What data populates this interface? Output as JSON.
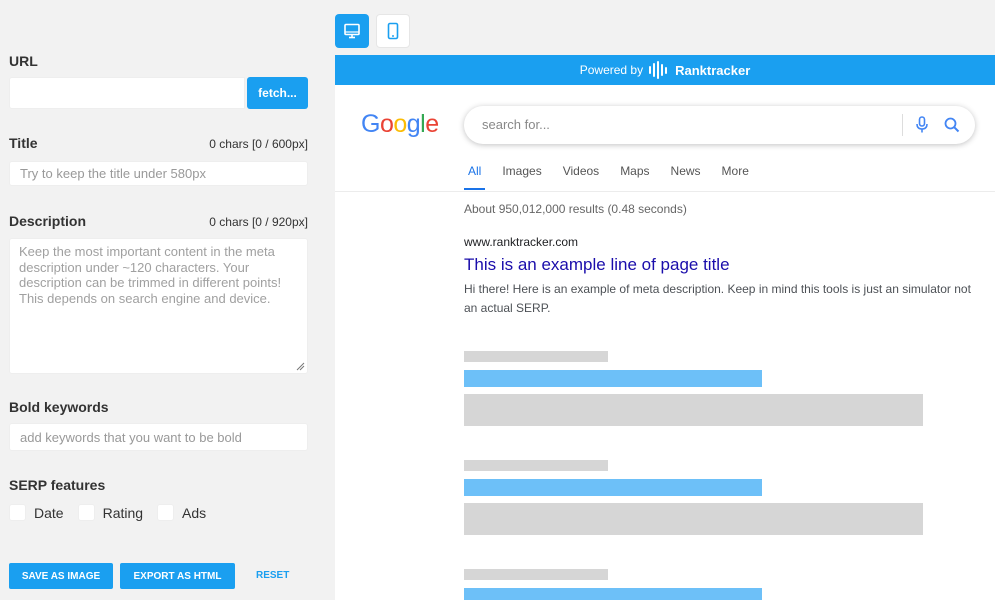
{
  "left": {
    "url_label": "URL",
    "url_value": "",
    "fetch_label": "fetch...",
    "title_label": "Title",
    "title_count": "0 chars [0 / 600px]",
    "title_placeholder": "Try to keep the title under 580px",
    "desc_label": "Description",
    "desc_count": "0 chars [0 / 920px]",
    "desc_placeholder": "Keep the most important content in the meta description under ~120 characters. Your description can be trimmed in different points! This depends on search engine and device.",
    "bold_label": "Bold keywords",
    "bold_placeholder": "add keywords that you want to be bold",
    "serp_label": "SERP features",
    "features": [
      "Date",
      "Rating",
      "Ads"
    ],
    "save_image": "SAVE AS IMAGE",
    "export_html": "EXPORT AS HTML",
    "reset": "RESET"
  },
  "devices": {
    "desktop_icon": "desktop-icon",
    "mobile_icon": "mobile-icon",
    "selected": "desktop"
  },
  "preview": {
    "powered_by": "Powered by",
    "brand": "Ranktracker",
    "logo": "Google",
    "search_placeholder": "search for...",
    "tabs": [
      "All",
      "Images",
      "Videos",
      "Maps",
      "News",
      "More"
    ],
    "active_tab": "All",
    "stats": "About 950,012,000 results (0.48 seconds)",
    "result_url": "www.ranktracker.com",
    "result_title": "This is an example line of page title",
    "result_desc": "Hi there! Here is an example of meta description. Keep in mind this tools is just an simulator not an actual SERP."
  },
  "colors": {
    "accent": "#1a9ff0",
    "link": "#1a0dab"
  }
}
